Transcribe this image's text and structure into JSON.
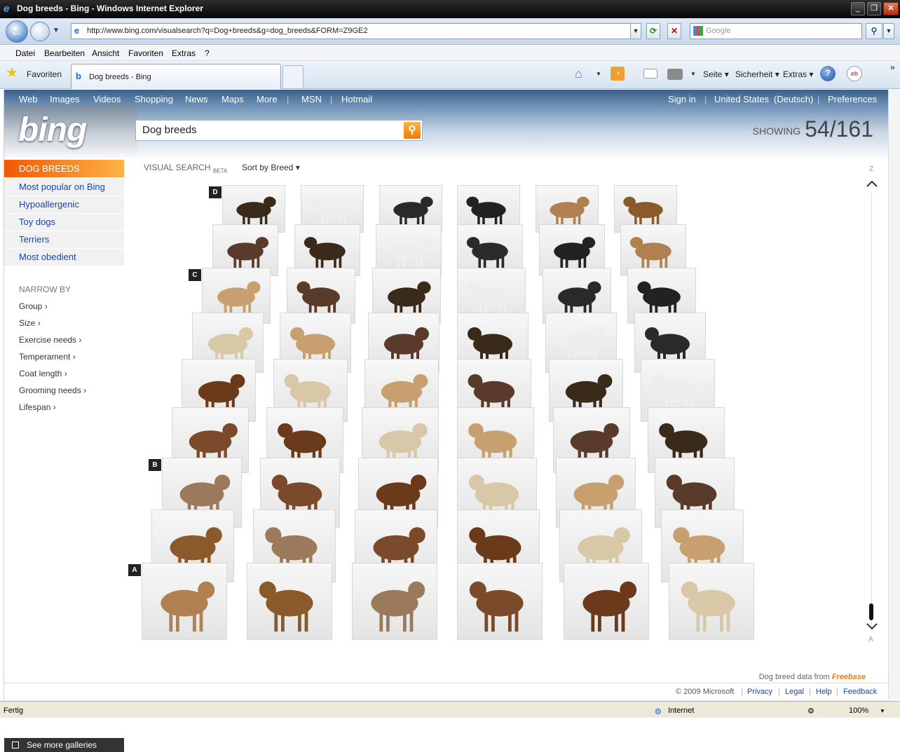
{
  "window": {
    "title": "Dog breeds - Bing - Windows Internet Explorer"
  },
  "address": {
    "url": "http://www.bing.com/visualsearch?q=Dog+breeds&g=dog_breeds&FORM=Z9GE2",
    "search_placeholder": "Google"
  },
  "menu": [
    "Datei",
    "Bearbeiten",
    "Ansicht",
    "Favoriten",
    "Extras",
    "?"
  ],
  "favorites_label": "Favoriten",
  "tab": {
    "label": "Dog breeds - Bing"
  },
  "commandbar": {
    "page": "Seite",
    "security": "Sicherheit",
    "tools": "Extras"
  },
  "bing": {
    "nav": [
      "Web",
      "Images",
      "Videos",
      "Shopping",
      "News",
      "Maps",
      "More",
      "MSN",
      "Hotmail"
    ],
    "account": {
      "signin": "Sign in",
      "region": "United States",
      "lang": "(Deutsch)",
      "prefs": "Preferences"
    },
    "logo": "bing",
    "query": "Dog breeds",
    "showing_label": "SHOWING",
    "showing_value": "54/161",
    "category_header": "DOG BREEDS",
    "category_links": [
      "Most popular on Bing",
      "Hypoallergenic",
      "Toy dogs",
      "Terriers",
      "Most obedient"
    ],
    "narrow_by": "NARROW BY",
    "filters": [
      "Group",
      "Size",
      "Exercise needs",
      "Temperament",
      "Coat length",
      "Grooming needs",
      "Lifespan"
    ],
    "visual_search": "VISUAL SEARCH",
    "beta": "BETA",
    "sort": "Sort by Breed",
    "row_labels": [
      "D",
      "C",
      "B",
      "A"
    ],
    "z_label": "Z",
    "a_label": "A",
    "more_galleries": "See more galleries",
    "credit_text": "Dog breed data from",
    "credit_brand": "Freebase",
    "footer": {
      "copyright": "© 2009 Microsoft",
      "links": [
        "Privacy",
        "Legal",
        "Help",
        "Feedback"
      ]
    }
  },
  "status": {
    "left": "Fertig",
    "zone": "Internet",
    "zoom": "100%"
  },
  "colors": {
    "accent_orange": "#f07c00",
    "link_blue": "#1a44a8",
    "ie_titlebar": "#1a1a1a"
  }
}
